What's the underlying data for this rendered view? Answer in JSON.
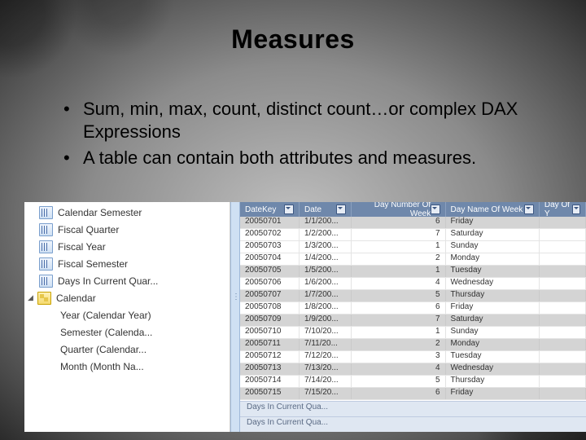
{
  "title": "Measures",
  "bullets": [
    "Sum, min, max, count, distinct count…or complex DAX Expressions",
    "A table can contain both attributes and measures."
  ],
  "fieldlist": {
    "items": [
      {
        "label": "Calendar Semester",
        "type": "column"
      },
      {
        "label": "Fiscal Quarter",
        "type": "column"
      },
      {
        "label": "Fiscal Year",
        "type": "column"
      },
      {
        "label": "Fiscal Semester",
        "type": "column"
      },
      {
        "label": "Days In Current Quar...",
        "type": "column"
      }
    ],
    "hierarchy": {
      "label": "Calendar",
      "expanded": true,
      "children": [
        "Year (Calendar Year)",
        "Semester (Calenda...",
        "Quarter (Calendar...",
        "Month (Month Na..."
      ]
    }
  },
  "chart_data": {
    "headers": [
      "DateKey",
      "Date",
      "Day Number Of Week",
      "Day Name Of Week",
      "Day Of Y"
    ],
    "rows": [
      {
        "sel": true,
        "c": [
          "20050701",
          "1/1/200...",
          "6",
          "Friday",
          ""
        ]
      },
      {
        "sel": false,
        "c": [
          "20050702",
          "1/2/200...",
          "7",
          "Saturday",
          ""
        ]
      },
      {
        "sel": false,
        "c": [
          "20050703",
          "1/3/200...",
          "1",
          "Sunday",
          ""
        ]
      },
      {
        "sel": false,
        "c": [
          "20050704",
          "1/4/200...",
          "2",
          "Monday",
          ""
        ]
      },
      {
        "sel": true,
        "c": [
          "20050705",
          "1/5/200...",
          "1",
          "Tuesday",
          ""
        ]
      },
      {
        "sel": false,
        "c": [
          "20050706",
          "1/6/200...",
          "4",
          "Wednesday",
          ""
        ]
      },
      {
        "sel": true,
        "c": [
          "20050707",
          "1/7/200...",
          "5",
          "Thursday",
          ""
        ]
      },
      {
        "sel": false,
        "c": [
          "20050708",
          "1/8/200...",
          "6",
          "Friday",
          ""
        ]
      },
      {
        "sel": true,
        "c": [
          "20050709",
          "1/9/200...",
          "7",
          "Saturday",
          ""
        ]
      },
      {
        "sel": false,
        "c": [
          "20050710",
          "7/10/20...",
          "1",
          "Sunday",
          ""
        ]
      },
      {
        "sel": true,
        "c": [
          "20050711",
          "7/11/20...",
          "2",
          "Monday",
          ""
        ]
      },
      {
        "sel": false,
        "c": [
          "20050712",
          "7/12/20...",
          "3",
          "Tuesday",
          ""
        ]
      },
      {
        "sel": true,
        "c": [
          "20050713",
          "7/13/20...",
          "4",
          "Wednesday",
          ""
        ]
      },
      {
        "sel": false,
        "c": [
          "20050714",
          "7/14/20...",
          "5",
          "Thursday",
          ""
        ]
      },
      {
        "sel": true,
        "c": [
          "20050715",
          "7/15/20...",
          "6",
          "Friday",
          ""
        ]
      }
    ],
    "footer": [
      "Days In Current Qua...",
      "Days In Current Qua..."
    ]
  }
}
